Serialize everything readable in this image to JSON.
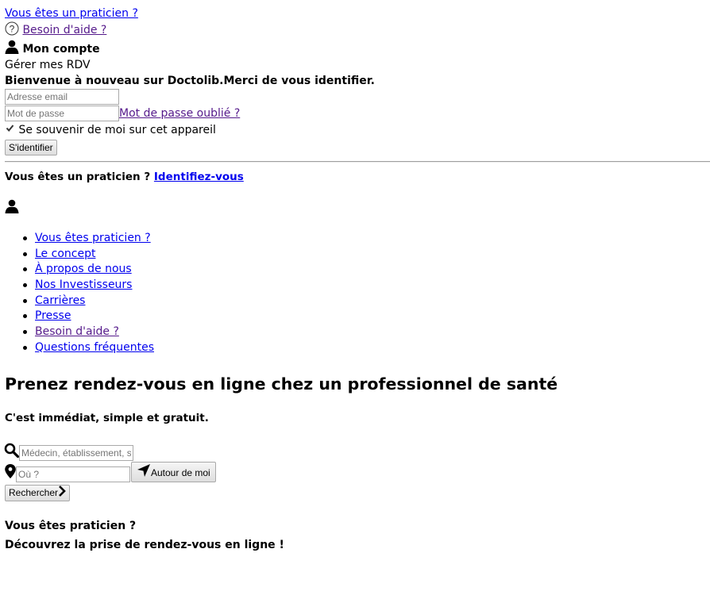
{
  "header": {
    "practitioner_link": "Vous êtes un praticien ?",
    "help_link": "Besoin d'aide ?",
    "account_label": "Mon compte",
    "manage_rdv": "Gérer mes RDV",
    "welcome": "Bienvenue à nouveau sur Doctolib.Merci de vous identifier."
  },
  "login": {
    "email_placeholder": "Adresse email",
    "password_placeholder": "Mot de passe",
    "forgot_link": "Mot de passe oublié ?",
    "remember_label": "Se souvenir de moi sur cet appareil",
    "remember_checked": true,
    "submit_label": "S'identifier"
  },
  "practitioner_bar": {
    "text": "Vous êtes un praticien ?",
    "link": "Identifiez-vous"
  },
  "menu": {
    "items": [
      {
        "label": "Vous êtes praticien ?"
      },
      {
        "label": "Le concept"
      },
      {
        "label": "À propos de nous"
      },
      {
        "label": "Nos Investisseurs"
      },
      {
        "label": "Carrières"
      },
      {
        "label": "Presse"
      },
      {
        "label": "Besoin d'aide ?"
      },
      {
        "label": "Questions fréquentes"
      }
    ]
  },
  "hero": {
    "title": "Prenez rendez-vous en ligne chez un professionnel de santé",
    "subtitle": "C'est immédiat, simple et gratuit."
  },
  "search": {
    "query_placeholder": "Médecin, établissement, spécialité...",
    "location_placeholder": "Où ?",
    "nearby_label": "Autour de moi",
    "submit_label": "Rechercher"
  },
  "promo": {
    "line1": "Vous êtes praticien ?",
    "line2": "Découvrez la prise de rendez-vous en ligne !"
  },
  "colors": {
    "link": "#0000ee",
    "visited_link": "#551a8b"
  }
}
